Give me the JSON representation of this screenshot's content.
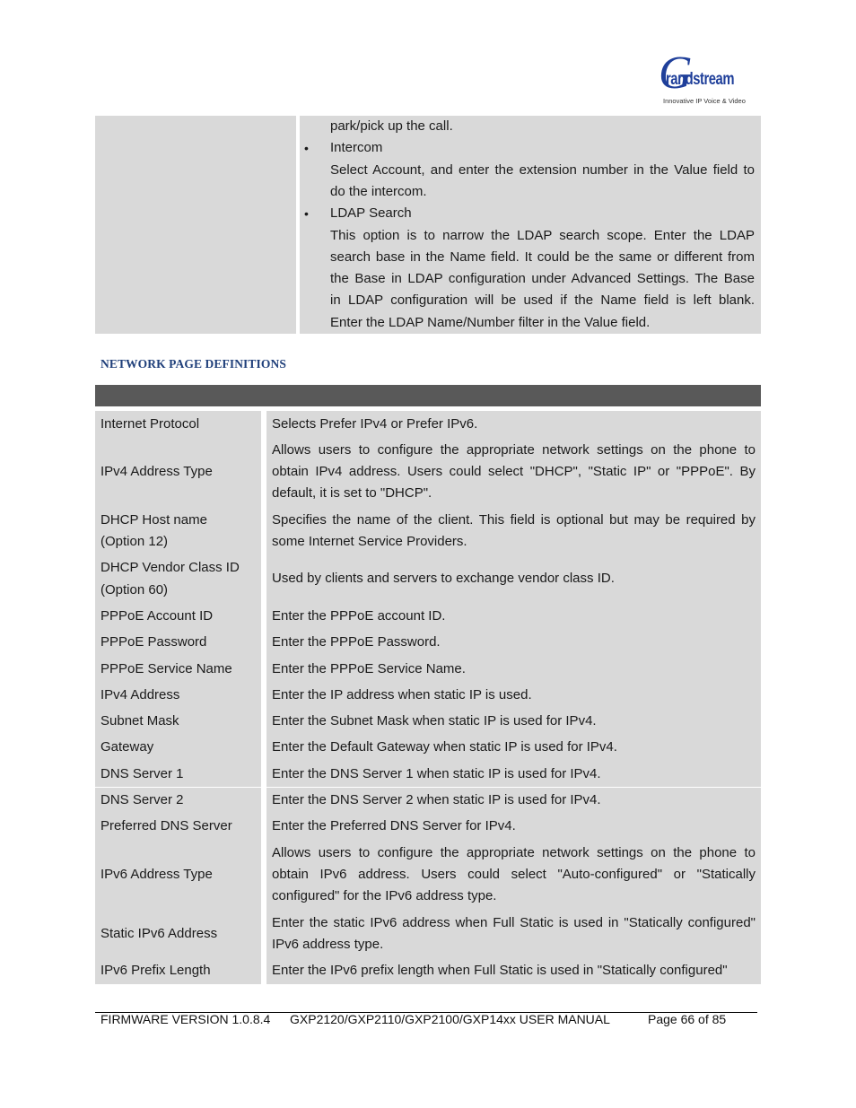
{
  "header": {
    "logo": {
      "brand": "randstream",
      "initial": "G",
      "tagline": "Innovative IP Voice & Video"
    }
  },
  "continuation": {
    "lines": [
      {
        "text": "park/pick up the call.",
        "bullet": false,
        "last": true
      },
      {
        "text": "Intercom",
        "bullet": true,
        "last": true
      },
      {
        "text": "Select Account, and enter the extension number in the Value field to",
        "bullet": false,
        "last": false
      },
      {
        "text": "do the intercom.",
        "bullet": false,
        "last": true
      },
      {
        "text": "LDAP Search",
        "bullet": true,
        "last": true
      },
      {
        "text": "This option is to narrow the LDAP search scope. Enter the LDAP",
        "bullet": false,
        "last": false
      },
      {
        "text": "search base in the Name field. It could be the same or different from",
        "bullet": false,
        "last": false
      },
      {
        "text": "the Base in LDAP configuration under Advanced Settings. The Base",
        "bullet": false,
        "last": false
      },
      {
        "text": "in LDAP configuration will be used if the Name field is left blank.",
        "bullet": false,
        "last": false
      },
      {
        "text": "Enter the LDAP Name/Number filter in the Value field.",
        "bullet": false,
        "last": true
      }
    ],
    "bullet_glyph": "•"
  },
  "section": {
    "title": "NETWORK PAGE DEFINITIONS"
  },
  "table": {
    "rows": [
      {
        "name": [
          "Internet Protocol"
        ],
        "desc": [
          "Selects Prefer IPv4 or Prefer IPv6."
        ]
      },
      {
        "name": [
          "IPv4 Address Type"
        ],
        "desc": [
          "Allows users to configure the appropriate network settings on the phone to",
          "obtain IPv4 address. Users could select \"DHCP\", \"Static IP\" or \"PPPoE\". By",
          "default, it is set to \"DHCP\"."
        ]
      },
      {
        "name": [
          "DHCP Host name",
          "(Option 12)"
        ],
        "desc": [
          "Specifies the name of the client. This field is optional but may be required by",
          "some Internet Service Providers."
        ]
      },
      {
        "name": [
          "DHCP Vendor Class ID",
          "(Option 60)"
        ],
        "desc": [
          "Used by clients and servers to exchange vendor class ID."
        ]
      },
      {
        "name": [
          "PPPoE Account ID"
        ],
        "desc": [
          "Enter the PPPoE account ID."
        ]
      },
      {
        "name": [
          "PPPoE Password"
        ],
        "desc": [
          "Enter the PPPoE Password."
        ]
      },
      {
        "name": [
          "PPPoE Service Name"
        ],
        "desc": [
          "Enter the PPPoE Service Name."
        ]
      },
      {
        "name": [
          "IPv4 Address"
        ],
        "desc": [
          "Enter the IP address when static IP is used."
        ]
      },
      {
        "name": [
          "Subnet Mask"
        ],
        "desc": [
          "Enter the Subnet Mask when static IP is used for IPv4."
        ]
      },
      {
        "name": [
          "Gateway"
        ],
        "desc": [
          "Enter the Default Gateway when static IP is used for IPv4."
        ]
      },
      {
        "name": [
          "DNS Server 1"
        ],
        "desc": [
          "Enter the DNS Server 1 when static IP is used for IPv4."
        ]
      },
      {
        "name": [
          "DNS Server 2"
        ],
        "desc": [
          "Enter the DNS Server 2 when static IP is used for IPv4."
        ]
      },
      {
        "name": [
          "Preferred DNS Server"
        ],
        "desc": [
          "Enter the Preferred DNS Server for IPv4."
        ]
      },
      {
        "name": [
          "IPv6 Address Type"
        ],
        "desc": [
          "Allows users to configure the appropriate network settings on the phone to",
          "obtain IPv6 address. Users could select \"Auto-configured\" or \"Statically",
          "configured\" for the IPv6 address type."
        ]
      },
      {
        "name": [
          "Static IPv6 Address"
        ],
        "desc": [
          "Enter the static IPv6 address when Full Static is used in \"Statically configured\"",
          "IPv6 address type."
        ]
      },
      {
        "name": [
          "IPv6 Prefix Length"
        ],
        "desc": [
          "Enter the IPv6 prefix length when Full Static is used in \"Statically configured\""
        ]
      }
    ]
  },
  "footer": {
    "firmware": "FIRMWARE VERSION 1.0.8.4",
    "manual": "GXP2120/GXP2110/GXP2100/GXP14xx USER MANUAL",
    "page": "Page 66 of 85"
  }
}
